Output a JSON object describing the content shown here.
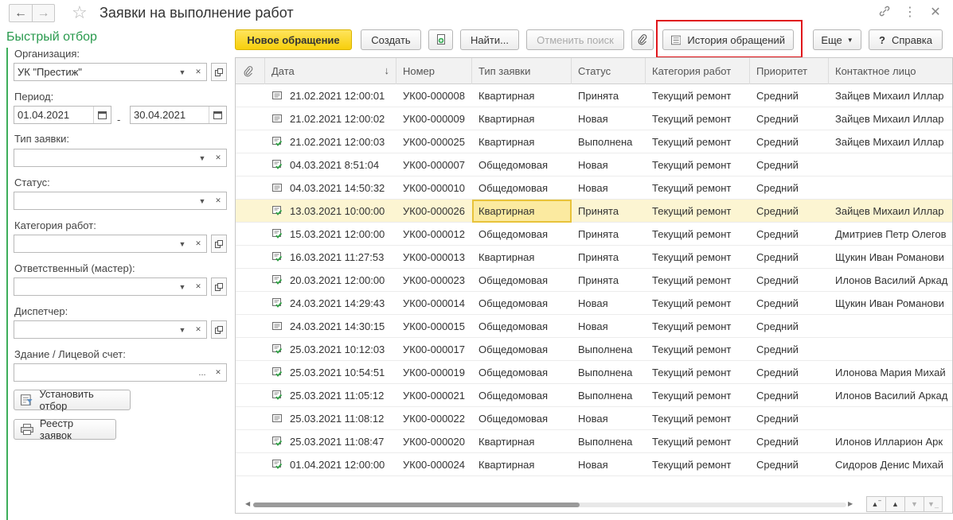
{
  "window": {
    "title": "Заявки на выполнение работ"
  },
  "filter": {
    "title": "Быстрый отбор",
    "org_label": "Организация:",
    "org_value": "УК \"Престиж\"",
    "period_label": "Период:",
    "period_from": "01.04.2021",
    "period_to": "30.04.2021",
    "period_dash": "-",
    "type_label": "Тип заявки:",
    "status_label": "Статус:",
    "category_label": "Категория работ:",
    "master_label": "Ответственный (мастер):",
    "dispatcher_label": "Диспетчер:",
    "building_label": "Здание / Лицевой счет:",
    "set_filter_btn": "Установить отбор",
    "registry_btn": "Реестр заявок",
    "ellipsis": "..."
  },
  "toolbar": {
    "new_request": "Новое обращение",
    "create": "Создать",
    "find": "Найти...",
    "cancel_search": "Отменить поиск",
    "history": "История обращений",
    "more": "Еще",
    "help": "Справка",
    "help_glyph": "?"
  },
  "table": {
    "columns": [
      "Дата",
      "Номер",
      "Тип заявки",
      "Статус",
      "Категория работ",
      "Приоритет",
      "Контактное лицо"
    ],
    "sort_indicator": "↓",
    "selected_row": 5,
    "rows": [
      {
        "icon": "doc",
        "date": "21.02.2021 12:00:01",
        "number": "УК00-000008",
        "type": "Квартирная",
        "status": "Принята",
        "category": "Текущий ремонт",
        "priority": "Средний",
        "contact": "Зайцев Михаил Иллар"
      },
      {
        "icon": "doc",
        "date": "21.02.2021 12:00:02",
        "number": "УК00-000009",
        "type": "Квартирная",
        "status": "Новая",
        "category": "Текущий ремонт",
        "priority": "Средний",
        "contact": "Зайцев Михаил Иллар"
      },
      {
        "icon": "doc-check",
        "date": "21.02.2021 12:00:03",
        "number": "УК00-000025",
        "type": "Квартирная",
        "status": "Выполнена",
        "category": "Текущий ремонт",
        "priority": "Средний",
        "contact": "Зайцев Михаил Иллар"
      },
      {
        "icon": "doc-check",
        "date": "04.03.2021 8:51:04",
        "number": "УК00-000007",
        "type": "Общедомовая",
        "status": "Новая",
        "category": "Текущий ремонт",
        "priority": "Средний",
        "contact": ""
      },
      {
        "icon": "doc",
        "date": "04.03.2021 14:50:32",
        "number": "УК00-000010",
        "type": "Общедомовая",
        "status": "Новая",
        "category": "Текущий ремонт",
        "priority": "Средний",
        "contact": ""
      },
      {
        "icon": "doc-check",
        "date": "13.03.2021 10:00:00",
        "number": "УК00-000026",
        "type": "Квартирная",
        "status": "Принята",
        "category": "Текущий ремонт",
        "priority": "Средний",
        "contact": "Зайцев Михаил Иллар"
      },
      {
        "icon": "doc-check",
        "date": "15.03.2021 12:00:00",
        "number": "УК00-000012",
        "type": "Общедомовая",
        "status": "Принята",
        "category": "Текущий ремонт",
        "priority": "Средний",
        "contact": "Дмитриев Петр Олегов"
      },
      {
        "icon": "doc-check",
        "date": "16.03.2021 11:27:53",
        "number": "УК00-000013",
        "type": "Квартирная",
        "status": "Принята",
        "category": "Текущий ремонт",
        "priority": "Средний",
        "contact": "Щукин Иван Романови"
      },
      {
        "icon": "doc-check",
        "date": "20.03.2021 12:00:00",
        "number": "УК00-000023",
        "type": "Общедомовая",
        "status": "Принята",
        "category": "Текущий ремонт",
        "priority": "Средний",
        "contact": "Илонов Василий Аркад"
      },
      {
        "icon": "doc-check",
        "date": "24.03.2021 14:29:43",
        "number": "УК00-000014",
        "type": "Общедомовая",
        "status": "Новая",
        "category": "Текущий ремонт",
        "priority": "Средний",
        "contact": "Щукин Иван Романови"
      },
      {
        "icon": "doc",
        "date": "24.03.2021 14:30:15",
        "number": "УК00-000015",
        "type": "Общедомовая",
        "status": "Новая",
        "category": "Текущий ремонт",
        "priority": "Средний",
        "contact": ""
      },
      {
        "icon": "doc-check",
        "date": "25.03.2021 10:12:03",
        "number": "УК00-000017",
        "type": "Общедомовая",
        "status": "Выполнена",
        "category": "Текущий ремонт",
        "priority": "Средний",
        "contact": ""
      },
      {
        "icon": "doc-check",
        "date": "25.03.2021 10:54:51",
        "number": "УК00-000019",
        "type": "Общедомовая",
        "status": "Выполнена",
        "category": "Текущий ремонт",
        "priority": "Средний",
        "contact": "Илонова Мария Михай"
      },
      {
        "icon": "doc-check",
        "date": "25.03.2021 11:05:12",
        "number": "УК00-000021",
        "type": "Общедомовая",
        "status": "Выполнена",
        "category": "Текущий ремонт",
        "priority": "Средний",
        "contact": "Илонов Василий Аркад"
      },
      {
        "icon": "doc",
        "date": "25.03.2021 11:08:12",
        "number": "УК00-000022",
        "type": "Общедомовая",
        "status": "Новая",
        "category": "Текущий ремонт",
        "priority": "Средний",
        "contact": ""
      },
      {
        "icon": "doc-check",
        "date": "25.03.2021 11:08:47",
        "number": "УК00-000020",
        "type": "Квартирная",
        "status": "Выполнена",
        "category": "Текущий ремонт",
        "priority": "Средний",
        "contact": "Илонов Илларион Арк"
      },
      {
        "icon": "doc-check",
        "date": "01.04.2021 12:00:00",
        "number": "УК00-000024",
        "type": "Квартирная",
        "status": "Новая",
        "category": "Текущий ремонт",
        "priority": "Средний",
        "contact": "Сидоров Денис Михай"
      }
    ]
  },
  "colors": {
    "accent_green": "#2a9a4e",
    "primary_yellow": "#f7cf0c",
    "highlight_red": "#e0161b",
    "selected_row": "#fcf5d2"
  },
  "icons": {
    "back": "arrow-left-icon",
    "forward": "arrow-right-icon",
    "favorite": "star-icon",
    "link": "link-icon",
    "menu": "more-vertical-icon",
    "close": "close-icon",
    "attachment": "paperclip-icon",
    "copy": "copy-doc-icon",
    "history": "list-icon",
    "filter": "filter-icon",
    "report": "printer-icon"
  }
}
